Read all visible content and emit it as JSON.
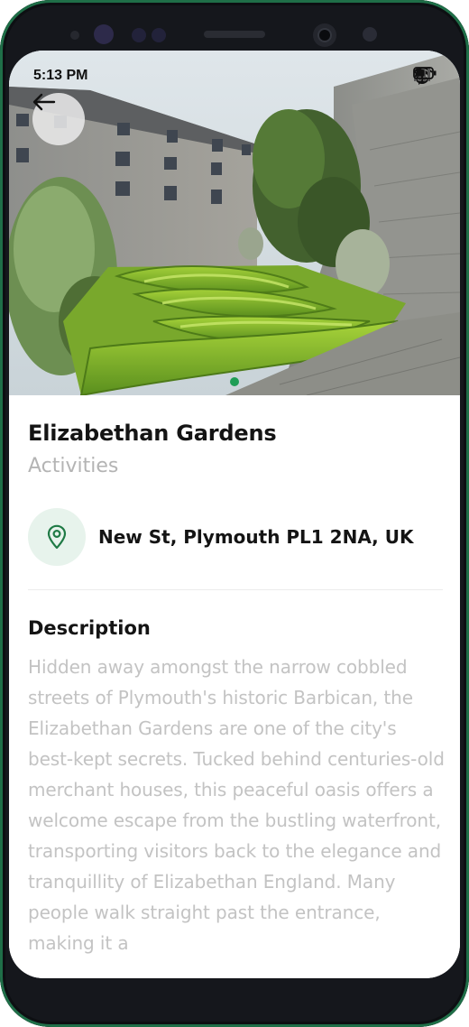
{
  "status_bar": {
    "time": "5:13 PM",
    "icons": [
      "alarm-icon",
      "bluetooth-icon",
      "wifi-icon",
      "signal-icon",
      "battery-icon"
    ]
  },
  "header": {
    "back_icon": "arrow-left-icon"
  },
  "place": {
    "title": "Elizabethan Gardens",
    "category": "Activities",
    "address": "New St, Plymouth PL1 2NA, UK",
    "address_icon": "map-pin-icon"
  },
  "description": {
    "heading": "Description",
    "body": "Hidden away amongst the narrow cobbled streets of Plymouth's historic Barbican, the Elizabethan Gardens are one of the city's best-kept secrets. Tucked behind centuries-old merchant houses, this peaceful oasis offers a welcome escape from the bustling waterfront, transporting visitors back to the elegance and tranquillity of Elizabethan England. Many people walk straight past the entrance, making it a"
  },
  "gallery": {
    "active_index": 0
  },
  "colors": {
    "accent": "#1f9d55",
    "accent_light": "#e7f3ec",
    "muted_text": "#c3c3c3"
  }
}
